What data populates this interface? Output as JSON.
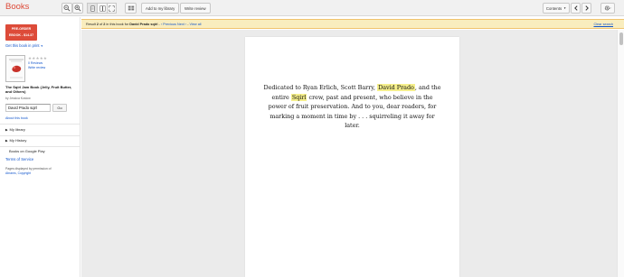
{
  "app": {
    "brand": "Books"
  },
  "toolbar": {
    "add_library_label": "Add to my library",
    "write_review_label": "Write review",
    "contents_label": "Contents"
  },
  "infobar": {
    "result_prefix": "Result",
    "result_num": "2",
    "result_of": "of",
    "result_total": "2",
    "result_mid": "in this book for",
    "query": "David Prado sqirl",
    "sep": "-",
    "previous": "‹ Previous",
    "next": "Next ›",
    "view_all": "View all",
    "clear_search": "Clear search"
  },
  "sidebar": {
    "preorder_line1": "PRE-ORDER",
    "preorder_line2": "EBOOK - $14.37",
    "print_link": "Get this book in print",
    "stars": "★★★★★",
    "reviews_count": "0 Reviews",
    "write_review": "Write review",
    "book_title": "The Sqirl Jam Book (Jelly, Fruit Butter, and Others)",
    "book_author": "by Jessica Koslow",
    "search_value": "David Prado sqirl",
    "go_label": "Go",
    "about_link": "About this book",
    "my_library": "My library",
    "my_history": "My History",
    "books_on_play": "Books on Google Play",
    "terms": "Terms of Service",
    "permission_text": "Pages displayed by permission of",
    "publisher": "Abrams",
    "copyright": "Copyright"
  },
  "page": {
    "line1_a": "Dedicated to Ryan Erlich, Scott Barry,",
    "line1_hl": "David Prado",
    "line1_b": ", and the entire",
    "line2_hl": "Sqirl",
    "line2_b": "crew, past and present, who believe in the power of fruit preservation. And to you, dear readers, for marking a moment in time by . . . squirreling it away for later."
  },
  "colors": {
    "brand": "#dd4b39",
    "link": "#1155cc",
    "highlight": "#f5ef8c",
    "infobar": "#f9edbe"
  },
  "icons": [
    "zoom-out-icon",
    "zoom-in-icon",
    "single-page-icon",
    "two-page-icon",
    "fullscreen-icon",
    "thumbnails-icon",
    "chevron-left-icon",
    "chevron-right-icon",
    "gear-icon"
  ]
}
